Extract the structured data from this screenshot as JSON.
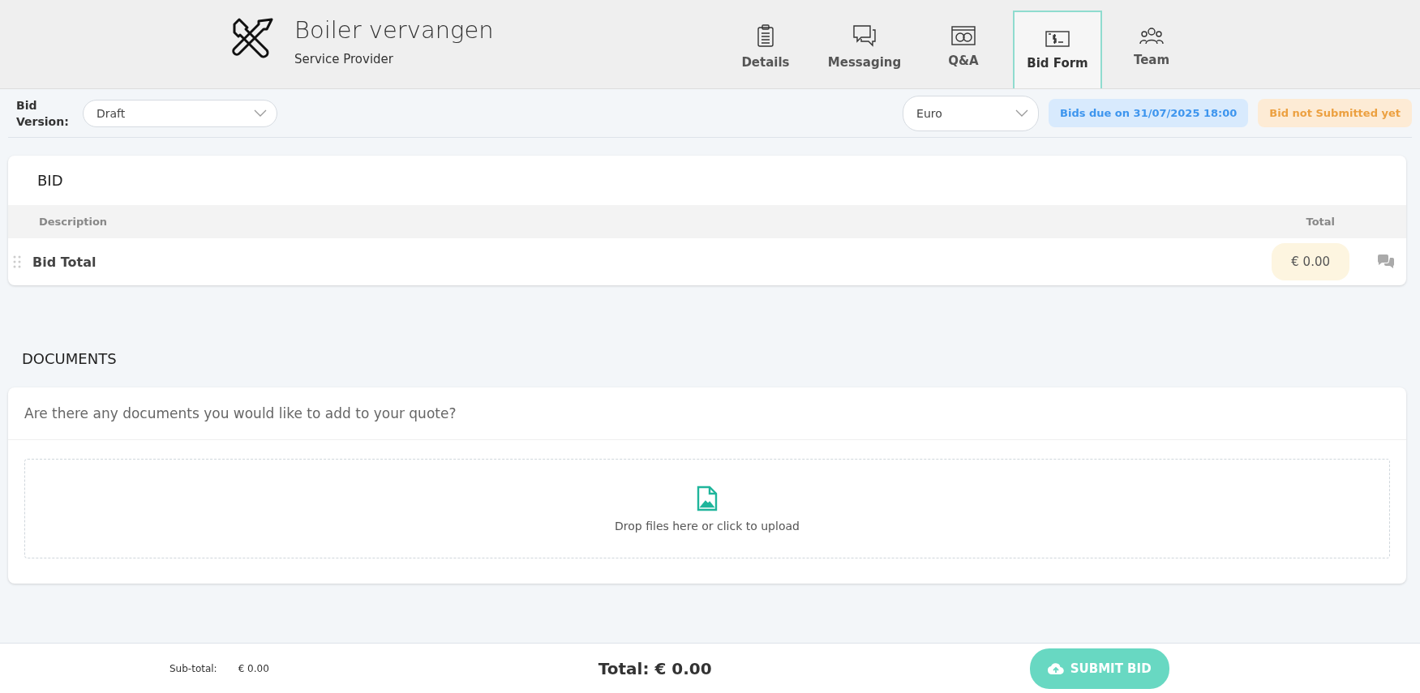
{
  "header": {
    "title": "Boiler vervangen",
    "subtitle": "Service Provider"
  },
  "tabs": [
    {
      "label": "Details",
      "kind": "clipboard",
      "selected": false
    },
    {
      "label": "Messaging",
      "kind": "chat",
      "selected": false
    },
    {
      "label": "Q&A",
      "kind": "qa",
      "selected": false
    },
    {
      "label": "Bid Form",
      "kind": "money",
      "selected": true
    },
    {
      "label": "Team",
      "kind": "team",
      "selected": false
    }
  ],
  "toolbar": {
    "version_label": "Bid Version:",
    "version_value": "Draft",
    "currency": "Euro",
    "due_badge": "Bids due on 31/07/2025 18:00",
    "status_badge": "Bid not Submitted yet"
  },
  "bid": {
    "title": "BID",
    "columns": [
      "Description",
      "Total"
    ],
    "rows": [
      {
        "description": "Bid Total",
        "total": "€ 0.00"
      }
    ]
  },
  "documents": {
    "title": "DOCUMENTS",
    "question": "Are there any documents you would like to add to your quote?",
    "dropzone": "Drop files here or click to upload"
  },
  "footer": {
    "subtotal_label": "Sub-total:",
    "subtotal_value": "€ 0.00",
    "total": "Total: € 0.00",
    "submit": "SUBMIT BID"
  }
}
